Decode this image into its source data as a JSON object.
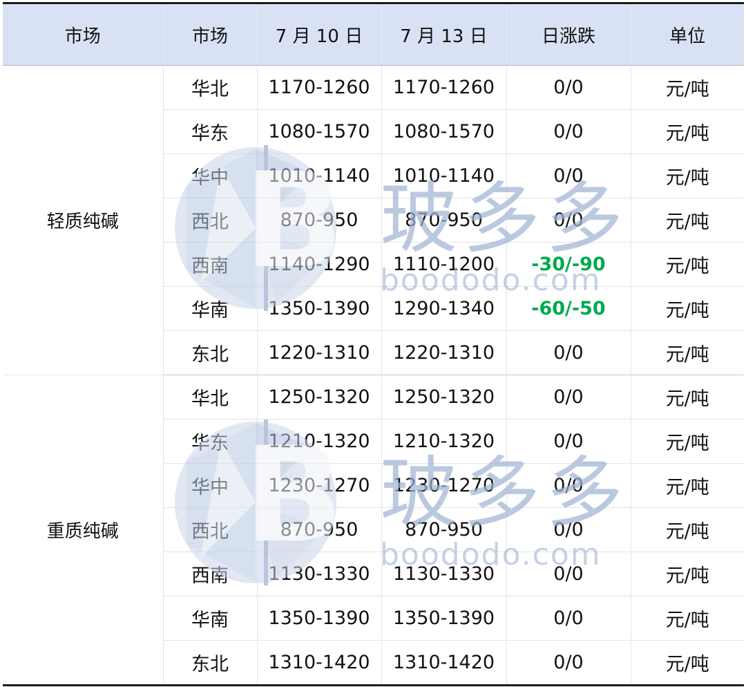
{
  "table": {
    "headers": [
      "市场",
      "市场",
      "7 月 10 日",
      "7 月 13 日",
      "日涨跌",
      "单位"
    ],
    "groups": [
      {
        "name": "轻质纯碱",
        "rows": [
          {
            "region": "华北",
            "jul10": "1170-1260",
            "jul13": "1170-1260",
            "change": "0/0",
            "unit": "元/吨",
            "down": false
          },
          {
            "region": "华东",
            "jul10": "1080-1570",
            "jul13": "1080-1570",
            "change": "0/0",
            "unit": "元/吨",
            "down": false
          },
          {
            "region": "华中",
            "jul10": "1010-1140",
            "jul13": "1010-1140",
            "change": "0/0",
            "unit": "元/吨",
            "down": false
          },
          {
            "region": "西北",
            "jul10": "870-950",
            "jul13": "870-950",
            "change": "0/0",
            "unit": "元/吨",
            "down": false
          },
          {
            "region": "西南",
            "jul10": "1140-1290",
            "jul13": "1110-1200",
            "change": "-30/-90",
            "unit": "元/吨",
            "down": true
          },
          {
            "region": "华南",
            "jul10": "1350-1390",
            "jul13": "1290-1340",
            "change": "-60/-50",
            "unit": "元/吨",
            "down": true
          },
          {
            "region": "东北",
            "jul10": "1220-1310",
            "jul13": "1220-1310",
            "change": "0/0",
            "unit": "元/吨",
            "down": false
          }
        ]
      },
      {
        "name": "重质纯碱",
        "rows": [
          {
            "region": "华北",
            "jul10": "1250-1320",
            "jul13": "1250-1320",
            "change": "0/0",
            "unit": "元/吨",
            "down": false
          },
          {
            "region": "华东",
            "jul10": "1210-1320",
            "jul13": "1210-1320",
            "change": "0/0",
            "unit": "元/吨",
            "down": false
          },
          {
            "region": "华中",
            "jul10": "1230-1270",
            "jul13": "1230-1270",
            "change": "0/0",
            "unit": "元/吨",
            "down": false
          },
          {
            "region": "西北",
            "jul10": "870-950",
            "jul13": "870-950",
            "change": "0/0",
            "unit": "元/吨",
            "down": false
          },
          {
            "region": "西南",
            "jul10": "1130-1330",
            "jul13": "1130-1330",
            "change": "0/0",
            "unit": "元/吨",
            "down": false
          },
          {
            "region": "华南",
            "jul10": "1350-1390",
            "jul13": "1350-1390",
            "change": "0/0",
            "unit": "元/吨",
            "down": false
          },
          {
            "region": "东北",
            "jul10": "1310-1420",
            "jul13": "1310-1420",
            "change": "0/0",
            "unit": "元/吨",
            "down": false
          }
        ]
      }
    ]
  },
  "watermark": {
    "logo_letter": "B",
    "brand_cn": "玻多多",
    "brand_url": "boododo.com"
  },
  "colors": {
    "header_bg": "#d9e2f4",
    "change_down": "#00a94f",
    "watermark": "#9fb3d4"
  }
}
